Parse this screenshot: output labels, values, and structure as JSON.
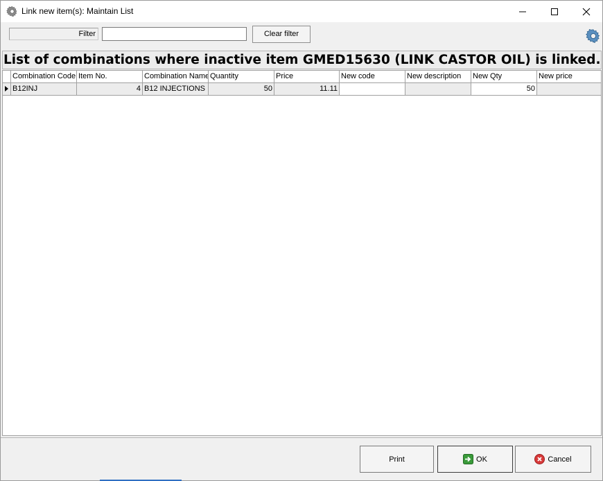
{
  "window": {
    "title": "Link new item(s): Maintain List",
    "icons": {
      "app": "gear-icon",
      "minimize": "minimize-icon",
      "maximize": "maximize-icon",
      "close": "close-icon"
    }
  },
  "filter": {
    "label": "Filter",
    "value": "",
    "clear_label": "Clear filter",
    "settings_icon": "settings-gear-icon"
  },
  "heading": "List of combinations where inactive item GMED15630 (LINK CASTOR OIL) is linked.",
  "table": {
    "columns": [
      "Combination Code",
      "Item No.",
      "Combination Name",
      "Quantity",
      "Price",
      "New code",
      "New description",
      "New Qty",
      "New price"
    ],
    "rows": [
      {
        "combination_code": "B12INJ",
        "item_no": "4",
        "combination_name": "B12 INJECTIONS",
        "quantity": "50",
        "price": "11.11",
        "new_code": "",
        "new_description": "",
        "new_qty": "50",
        "new_price": ""
      }
    ]
  },
  "footer": {
    "print_label": "Print",
    "ok_label": "OK",
    "cancel_label": "Cancel",
    "ok_icon": "arrow-right-icon",
    "cancel_icon": "cancel-circle-icon"
  },
  "colors": {
    "ok_icon": "#3a9a3a",
    "cancel_icon": "#d83a3a",
    "taskbar_accent": "#2f6fc2"
  }
}
